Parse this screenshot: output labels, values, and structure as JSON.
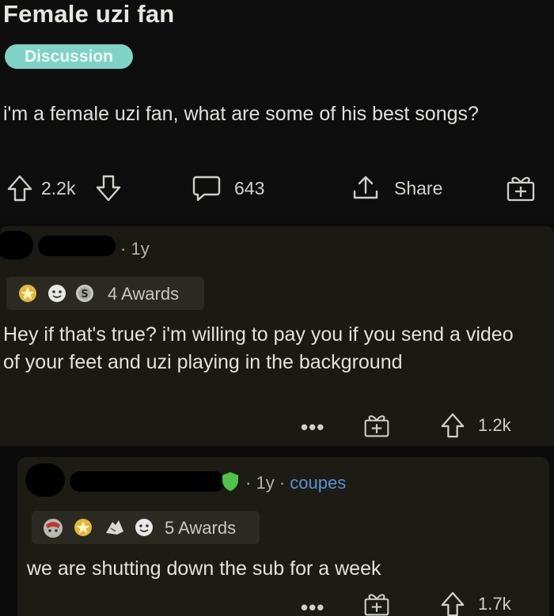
{
  "post": {
    "title": "Female uzi fan",
    "flair": "Discussion",
    "body": "i'm a female uzi fan, what are some of his best songs?",
    "upvotes": "2.2k",
    "comments": "643",
    "share_label": "Share"
  },
  "comment1": {
    "age": "1y",
    "awards_label": "4 Awards",
    "text": "Hey if that's true? i'm willing to pay you if you send a video of your feet and uzi playing in the background",
    "more": "•••",
    "score": "1.2k"
  },
  "comment2": {
    "age": "1y",
    "flair": "coupes",
    "awards_label": "5 Awards",
    "text": "we are shutting down the sub for a week",
    "more": "•••",
    "score": "1.7k"
  },
  "colors": {
    "flair_bg": "#7ed3c6",
    "comment_bg": "#1a1a12",
    "user_flair_blue": "#5b8fd6",
    "mod_shield_green": "#4fc34a"
  }
}
